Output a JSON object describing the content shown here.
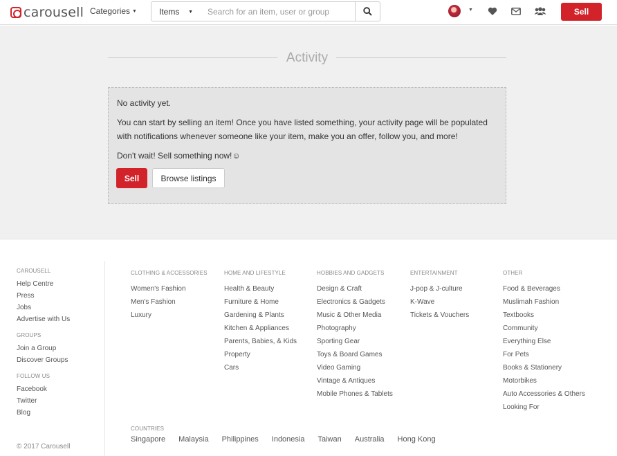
{
  "header": {
    "logo_text": "carousell",
    "categories_label": "Categories",
    "search_scope": "Items",
    "search_placeholder": "Search for an item, user or group",
    "sell_label": "Sell"
  },
  "activity": {
    "title": "Activity",
    "no_activity": "No activity yet.",
    "description": "You can start by selling an item! Once you have listed something, your activity page will be populated with notifications whenever someone like your item, make you an offer, follow you, and more!",
    "cta_text": "Don't wait! Sell something now!☺",
    "sell_label": "Sell",
    "browse_label": "Browse listings"
  },
  "footer": {
    "carousell": {
      "heading": "CAROUSELL",
      "links": [
        "Help Centre",
        "Press",
        "Jobs",
        "Advertise with Us"
      ]
    },
    "groups": {
      "heading": "GROUPS",
      "links": [
        "Join a Group",
        "Discover Groups"
      ]
    },
    "follow": {
      "heading": "FOLLOW US",
      "links": [
        "Facebook",
        "Twitter",
        "Blog"
      ]
    },
    "copyright": "© 2017 Carousell",
    "categories": [
      {
        "heading": "CLOTHING & ACCESSORIES",
        "links": [
          "Women's Fashion",
          "Men's Fashion",
          "Luxury"
        ]
      },
      {
        "heading": "HOME AND LIFESTYLE",
        "links": [
          "Health & Beauty",
          "Furniture & Home",
          "Gardening & Plants",
          "Kitchen & Appliances",
          "Parents, Babies, & Kids",
          "Property",
          "Cars"
        ]
      },
      {
        "heading": "HOBBIES AND GADGETS",
        "links": [
          "Design & Craft",
          "Electronics & Gadgets",
          "Music & Other Media",
          "Photography",
          "Sporting Gear",
          "Toys & Board Games",
          "Video Gaming",
          "Vintage & Antiques",
          "Mobile Phones & Tablets"
        ]
      },
      {
        "heading": "ENTERTAINMENT",
        "links": [
          "J-pop & J-culture",
          "K-Wave",
          "Tickets & Vouchers"
        ]
      },
      {
        "heading": "OTHER",
        "links": [
          "Food & Beverages",
          "Muslimah Fashion",
          "Textbooks",
          "Community",
          "Everything Else",
          "For Pets",
          "Books & Stationery",
          "Motorbikes",
          "Auto Accessories & Others",
          "Looking For"
        ]
      }
    ],
    "countries": {
      "heading": "COUNTRIES",
      "list": [
        "Singapore",
        "Malaysia",
        "Philippines",
        "Indonesia",
        "Taiwan",
        "Australia",
        "Hong Kong"
      ]
    }
  },
  "colors": {
    "brand_red": "#d2232a"
  },
  "icons": [
    "search-icon",
    "chevron-down-icon",
    "heart-icon",
    "mail-icon",
    "groups-icon"
  ]
}
